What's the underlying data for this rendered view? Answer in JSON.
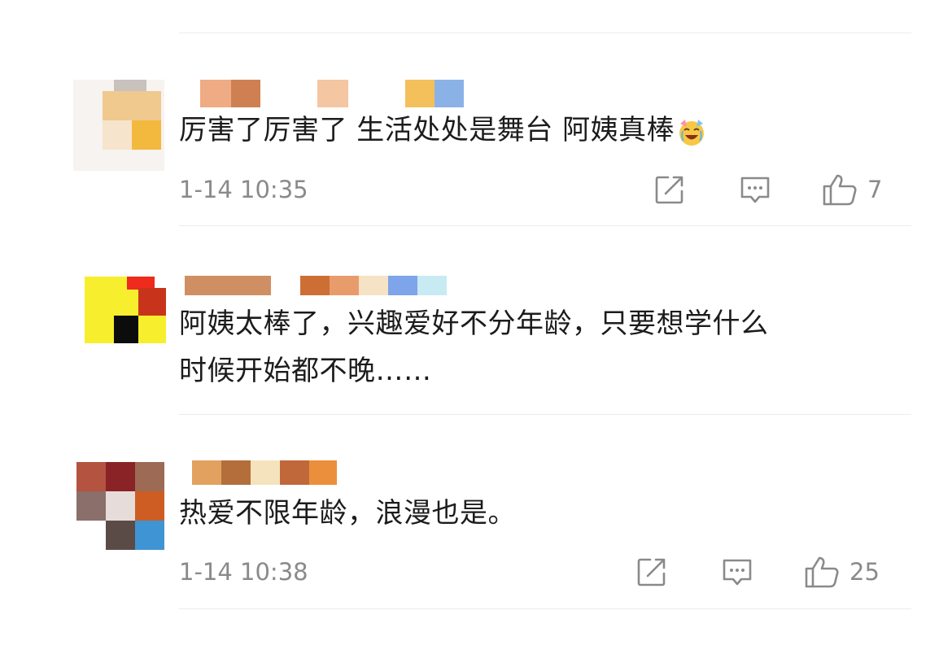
{
  "comments": [
    {
      "text_before_emoji": "厉害了厉害了 生活处处是舞台 阿姨真棒",
      "emoji": "laughing-crying-emoji",
      "time": "1-14 10:35",
      "likes": "7"
    },
    {
      "line1": "阿姨太棒了，兴趣爱好不分年龄，只要想学什么",
      "line2": "时候开始都不晚……"
    },
    {
      "text": "热爱不限年龄，浪漫也是。",
      "time": "1-14 10:38",
      "likes": "25"
    }
  ],
  "icons": {
    "share": "share-icon",
    "comment": "comment-icon",
    "like": "thumbs-up-icon"
  },
  "colors": {
    "text": "#1c1c1c",
    "meta": "#8a8a8a",
    "divider": "#ececec",
    "icon": "#8a8a8a"
  }
}
